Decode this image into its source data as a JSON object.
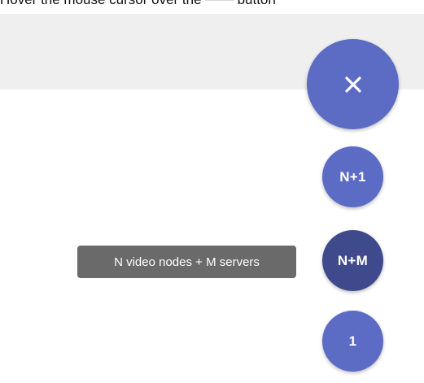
{
  "instruction": {
    "text_before": "Hover the mouse cursor over the",
    "text_after": "button"
  },
  "fab_menu": {
    "main_button": {
      "icon": "close-icon",
      "color": "#5c6bc4"
    },
    "options": [
      {
        "label": "N+1",
        "color": "#5c6bc4"
      },
      {
        "label": "N+M",
        "color": "#3f4a8d"
      },
      {
        "label": "1",
        "color": "#5c6bc4"
      }
    ],
    "tooltip": "N video nodes + M servers"
  }
}
